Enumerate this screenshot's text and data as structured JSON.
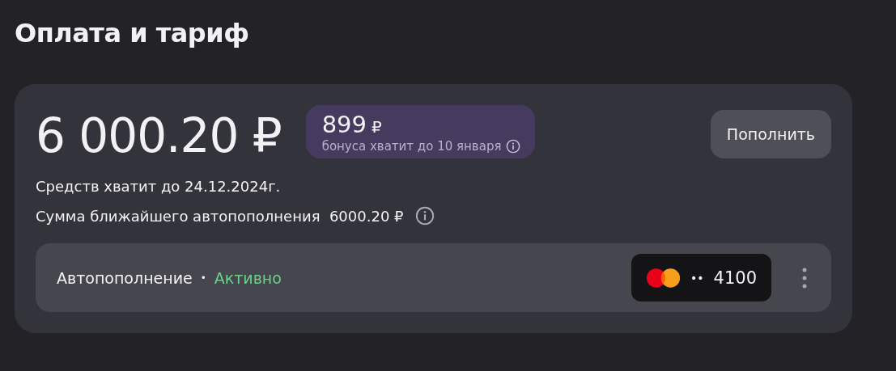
{
  "title": "Оплата и тариф",
  "balance": {
    "amount": "6 000.20 ₽"
  },
  "bonus": {
    "amount": "899",
    "currency": "₽",
    "note": "бонуса хватит до 10 января"
  },
  "top_up_button": "Пополнить",
  "info_lines": [
    {
      "text": "Средств хватит до 24.12.2024г.",
      "has_info": false
    },
    {
      "text": "Сумма ближайшего автопополнения  6000.20 ₽",
      "has_info": true
    }
  ],
  "autopay": {
    "label": "Автопополнение",
    "separator": "•",
    "status": "Активно",
    "active": true,
    "card": {
      "number": "4100",
      "mask": "••"
    }
  }
}
